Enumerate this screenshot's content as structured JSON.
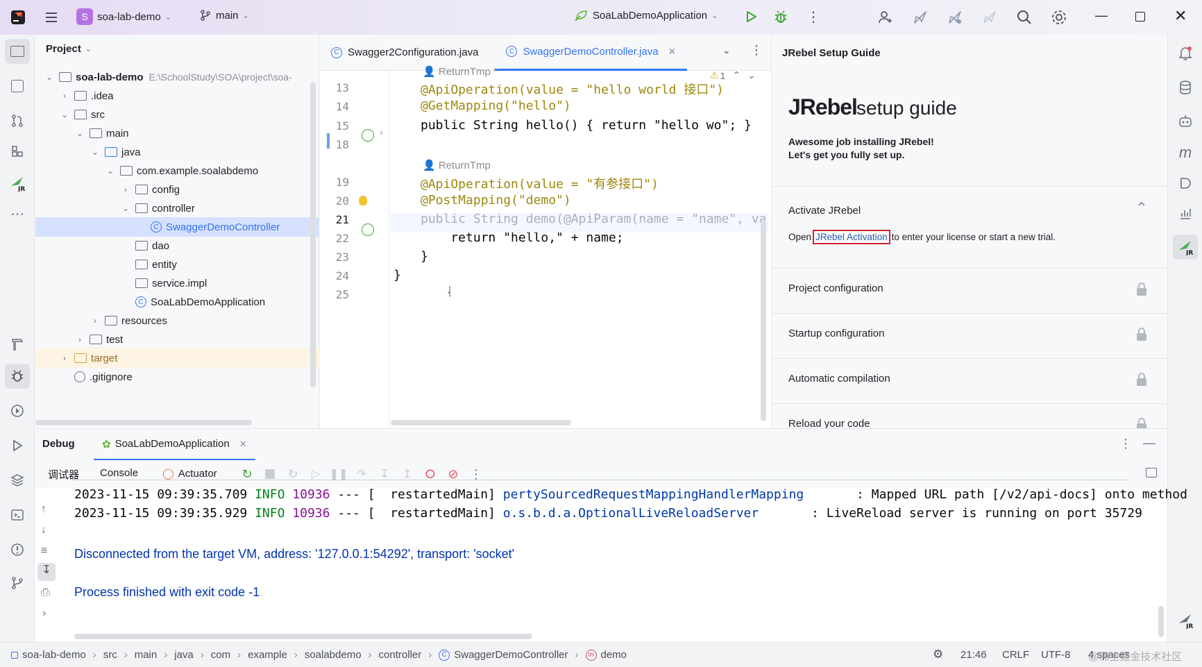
{
  "titlebar": {
    "project_initial": "S",
    "project_name": "soa-lab-demo",
    "branch": "main",
    "run_config": "SoaLabDemoApplication"
  },
  "project_panel": {
    "title": "Project",
    "tree": [
      {
        "label": "soa-lab-demo",
        "path": "E:\\SchoolStudy\\SOA\\project\\soa-",
        "indent": 0,
        "expanded": true,
        "kind": "module"
      },
      {
        "label": ".idea",
        "indent": 1,
        "expanded": false,
        "kind": "folder"
      },
      {
        "label": "src",
        "indent": 1,
        "expanded": true,
        "kind": "folder"
      },
      {
        "label": "main",
        "indent": 2,
        "expanded": true,
        "kind": "folder"
      },
      {
        "label": "java",
        "indent": 3,
        "expanded": true,
        "kind": "source-folder"
      },
      {
        "label": "com.example.soalabdemo",
        "indent": 4,
        "expanded": true,
        "kind": "package"
      },
      {
        "label": "config",
        "indent": 5,
        "expanded": false,
        "kind": "package"
      },
      {
        "label": "controller",
        "indent": 5,
        "expanded": true,
        "kind": "package"
      },
      {
        "label": "SwaggerDemoController",
        "indent": 6,
        "kind": "class",
        "selected": true
      },
      {
        "label": "dao",
        "indent": 5,
        "kind": "package"
      },
      {
        "label": "entity",
        "indent": 5,
        "kind": "package"
      },
      {
        "label": "service.impl",
        "indent": 5,
        "kind": "package"
      },
      {
        "label": "SoaLabDemoApplication",
        "indent": 5,
        "kind": "app-class"
      },
      {
        "label": "resources",
        "indent": 3,
        "expanded": false,
        "kind": "folder"
      },
      {
        "label": "test",
        "indent": 2,
        "expanded": false,
        "kind": "folder"
      },
      {
        "label": "target",
        "indent": 1,
        "expanded": false,
        "kind": "excluded-folder"
      },
      {
        "label": ".gitignore",
        "indent": 1,
        "kind": "file"
      }
    ]
  },
  "editor": {
    "tabs": [
      {
        "label": "Swagger2Configuration.java",
        "active": false
      },
      {
        "label": "SwaggerDemoController.java",
        "active": true
      }
    ],
    "warning_count": "1",
    "hint1": "ReturnTmp *",
    "hint2": "ReturnTmp",
    "lines": [
      {
        "n": "13",
        "code": "@ApiOperation(value = \"hello world 接口\")"
      },
      {
        "n": "14",
        "code": "@GetMapping(\"hello\")"
      },
      {
        "n": "15",
        "code": "public String hello() { return \"hello wo\"; }"
      },
      {
        "n": "18",
        "code": ""
      },
      {
        "n": "19",
        "code": "@ApiOperation(value = \"有参接口\")"
      },
      {
        "n": "20",
        "code": "@PostMapping(\"demo\")"
      },
      {
        "n": "21",
        "code": "public String demo(@ApiParam(name = \"name\", va"
      },
      {
        "n": "22",
        "code": "    return \"hello,\" + name;"
      },
      {
        "n": "23",
        "code": "}"
      },
      {
        "n": "24",
        "code": "}"
      },
      {
        "n": "25",
        "code": ""
      }
    ]
  },
  "jrebel": {
    "panel_title": "JRebel Setup Guide",
    "logo": "JRebel",
    "heading": "setup guide",
    "intro1": "Awesome job installing JRebel!",
    "intro2": "Let's get you fully set up.",
    "activate_title": "Activate JRebel",
    "activate_pre": "Open",
    "activate_link": "JRebel Activation",
    "activate_post": "to enter your license or start a new trial.",
    "sections": [
      "Project configuration",
      "Startup configuration",
      "Automatic compilation",
      "Reload your code"
    ]
  },
  "debug": {
    "tab_label": "Debug",
    "session": "SoaLabDemoApplication",
    "subtabs": [
      "调试器",
      "Console",
      "Actuator"
    ],
    "console": {
      "lines": [
        {
          "date": "2023-11-15 09:39:35.709",
          "level": "INFO",
          "pid": "10936",
          "dash": "---",
          "thread": "[  restartedMain]",
          "logger": "pertySourcedRequestMappingHandlerMapping",
          "msg": ": Mapped URL path [/v2/api-docs] onto method"
        },
        {
          "date": "2023-11-15 09:39:35.929",
          "level": "INFO",
          "pid": "10936",
          "dash": "---",
          "thread": "[  restartedMain]",
          "logger": "o.s.b.d.a.OptionalLiveReloadServer",
          "msg": ": LiveReload server is running on port 35729"
        }
      ],
      "disconnect": "Disconnected from the target VM, address: '127.0.0.1:54292', transport: 'socket'",
      "finished": "Process finished with exit code -1"
    }
  },
  "statusbar": {
    "breadcrumbs": [
      "soa-lab-demo",
      "src",
      "main",
      "java",
      "com",
      "example",
      "soalabdemo",
      "controller",
      "SwaggerDemoController",
      "demo"
    ],
    "position": "21:46",
    "line_sep": "CRLF",
    "encoding": "UTF-8",
    "indent": "4 spaces",
    "watermark": "@稀土掘金技术社区"
  }
}
